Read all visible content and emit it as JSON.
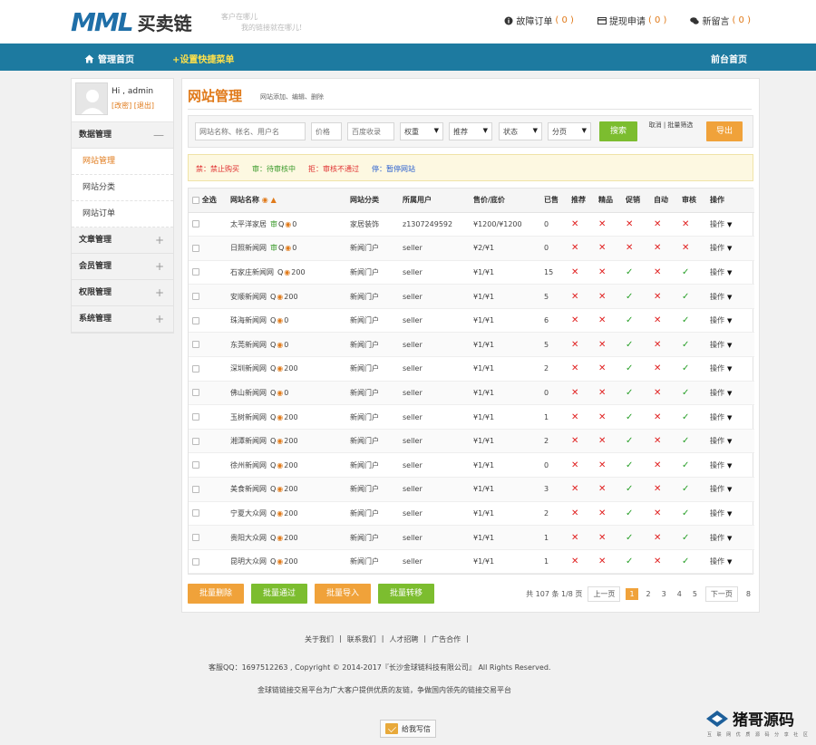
{
  "header": {
    "logo_text": "MML",
    "logo_cn": "买卖链",
    "slogan_line1": "客户在哪儿",
    "slogan_line2": "我的链接就在哪儿!",
    "links": [
      {
        "label": "故障订单",
        "count": "( 0 )",
        "icon": "info-icon"
      },
      {
        "label": "提现申请",
        "count": "( 0 )",
        "icon": "card-icon"
      },
      {
        "label": "新留言",
        "count": "( 0 )",
        "icon": "chat-icon"
      }
    ]
  },
  "nav": {
    "home": "管理首页",
    "add_shortcut": "+设置快捷菜单",
    "front": "前台首页"
  },
  "sidebar": {
    "greeting": "Hi , admin",
    "change_pwd": "[改密]",
    "logout": "[退出]",
    "groups": [
      {
        "label": "数据管理",
        "toggle": "—",
        "items": [
          "网站管理",
          "网站分类",
          "网站订单"
        ]
      },
      {
        "label": "文章管理",
        "toggle": "+"
      },
      {
        "label": "会员管理",
        "toggle": "+"
      },
      {
        "label": "权限管理",
        "toggle": "+"
      },
      {
        "label": "系统管理",
        "toggle": "+"
      }
    ]
  },
  "page": {
    "title": "网站管理",
    "subtitle": "网站添加、编辑、删除"
  },
  "filter": {
    "keyword_placeholder": "网站名称、帐名、用户名",
    "price_placeholder": "价格",
    "pr_placeholder": "百度收录",
    "selects": [
      "权重",
      "推荐",
      "状态",
      "分页"
    ],
    "search_label": "搜索",
    "cancel_select": "取消 | 批量筛选",
    "export_label": "导出"
  },
  "legend": {
    "items": [
      {
        "text": "禁：禁止购买",
        "color": "red"
      },
      {
        "text": "审：待审核中",
        "color": "green"
      },
      {
        "text": "拒：审核不通过",
        "color": "red"
      },
      {
        "text": "停：暂停网站",
        "color": "blue"
      }
    ]
  },
  "table": {
    "columns": [
      "全选",
      "网站名称",
      "网站分类",
      "所属用户",
      "售价/底价",
      "已售",
      "推荐",
      "精品",
      "促销",
      "自动",
      "审核",
      "操作"
    ],
    "op_label": "操作",
    "rows": [
      {
        "name": "太平洋家居",
        "pr": "0",
        "cat": "家居装饰",
        "user": "z1307249592",
        "price": "¥1200/¥1200",
        "sold": "0",
        "flags": [
          "x",
          "x",
          "x",
          "x",
          "x"
        ],
        "audit_icon": true
      },
      {
        "name": "日照新闻网",
        "pr": "0",
        "cat": "新闻门户",
        "user": "seller",
        "price": "¥2/¥1",
        "sold": "0",
        "flags": [
          "x",
          "x",
          "x",
          "x",
          "x"
        ],
        "audit_icon": true
      },
      {
        "name": "石家庄新闻网",
        "pr": "200",
        "cat": "新闻门户",
        "user": "seller",
        "price": "¥1/¥1",
        "sold": "15",
        "flags": [
          "x",
          "x",
          "v",
          "x",
          "v"
        ]
      },
      {
        "name": "安顺新闻网",
        "pr": "200",
        "cat": "新闻门户",
        "user": "seller",
        "price": "¥1/¥1",
        "sold": "5",
        "flags": [
          "x",
          "x",
          "v",
          "x",
          "v"
        ]
      },
      {
        "name": "珠海新闻网",
        "pr": "0",
        "cat": "新闻门户",
        "user": "seller",
        "price": "¥1/¥1",
        "sold": "6",
        "flags": [
          "x",
          "x",
          "v",
          "x",
          "v"
        ]
      },
      {
        "name": "东莞新闻网",
        "pr": "0",
        "cat": "新闻门户",
        "user": "seller",
        "price": "¥1/¥1",
        "sold": "5",
        "flags": [
          "x",
          "x",
          "v",
          "x",
          "v"
        ]
      },
      {
        "name": "深圳新闻网",
        "pr": "200",
        "cat": "新闻门户",
        "user": "seller",
        "price": "¥1/¥1",
        "sold": "2",
        "flags": [
          "x",
          "x",
          "v",
          "x",
          "v"
        ]
      },
      {
        "name": "佛山新闻网",
        "pr": "0",
        "cat": "新闻门户",
        "user": "seller",
        "price": "¥1/¥1",
        "sold": "0",
        "flags": [
          "x",
          "x",
          "v",
          "x",
          "v"
        ]
      },
      {
        "name": "玉树新闻网",
        "pr": "200",
        "cat": "新闻门户",
        "user": "seller",
        "price": "¥1/¥1",
        "sold": "1",
        "flags": [
          "x",
          "x",
          "v",
          "x",
          "v"
        ]
      },
      {
        "name": "湘潭新闻网",
        "pr": "200",
        "cat": "新闻门户",
        "user": "seller",
        "price": "¥1/¥1",
        "sold": "2",
        "flags": [
          "x",
          "x",
          "v",
          "x",
          "v"
        ]
      },
      {
        "name": "徐州新闻网",
        "pr": "200",
        "cat": "新闻门户",
        "user": "seller",
        "price": "¥1/¥1",
        "sold": "0",
        "flags": [
          "x",
          "x",
          "v",
          "x",
          "v"
        ]
      },
      {
        "name": "美食新闻网",
        "pr": "200",
        "cat": "新闻门户",
        "user": "seller",
        "price": "¥1/¥1",
        "sold": "3",
        "flags": [
          "x",
          "x",
          "v",
          "x",
          "v"
        ]
      },
      {
        "name": "宁夏大众网",
        "pr": "200",
        "cat": "新闻门户",
        "user": "seller",
        "price": "¥1/¥1",
        "sold": "2",
        "flags": [
          "x",
          "x",
          "v",
          "x",
          "v"
        ]
      },
      {
        "name": "贵阳大众网",
        "pr": "200",
        "cat": "新闻门户",
        "user": "seller",
        "price": "¥1/¥1",
        "sold": "1",
        "flags": [
          "x",
          "x",
          "v",
          "x",
          "v"
        ]
      },
      {
        "name": "昆明大众网",
        "pr": "200",
        "cat": "新闻门户",
        "user": "seller",
        "price": "¥1/¥1",
        "sold": "1",
        "flags": [
          "x",
          "x",
          "v",
          "x",
          "v"
        ]
      }
    ]
  },
  "bulk": {
    "delete": "批量删除",
    "approve": "批量通过",
    "import": "批量导入",
    "transfer": "批量转移"
  },
  "pager": {
    "summary": "共 107 条 1/8 页",
    "prev": "上一页",
    "pages": [
      "1",
      "2",
      "3",
      "4",
      "5"
    ],
    "next": "下一页",
    "last": "8"
  },
  "footer": {
    "links": [
      "关于我们",
      "|",
      "联系我们",
      "|",
      "人才招聘",
      "|",
      "广告合作",
      "|"
    ],
    "copyright": "客服QQ：1697512263 , Copyright © 2014-2017『长沙金球链科技有限公司』 All Rights Reserved.",
    "slogan": "金球链链接交易平台为广大客户提供优质的友链，争做国内领先的链接交易平台",
    "write_letter": "给我写信"
  },
  "watermark": {
    "title": "猪哥源码",
    "subtitle": "互 联 网 优 质 源 码 分 享 社 区"
  },
  "colors": {
    "nav": "#1d7aa0",
    "accent": "#e07a1a",
    "green": "#7cbd2f",
    "orange": "#f0a23a"
  }
}
